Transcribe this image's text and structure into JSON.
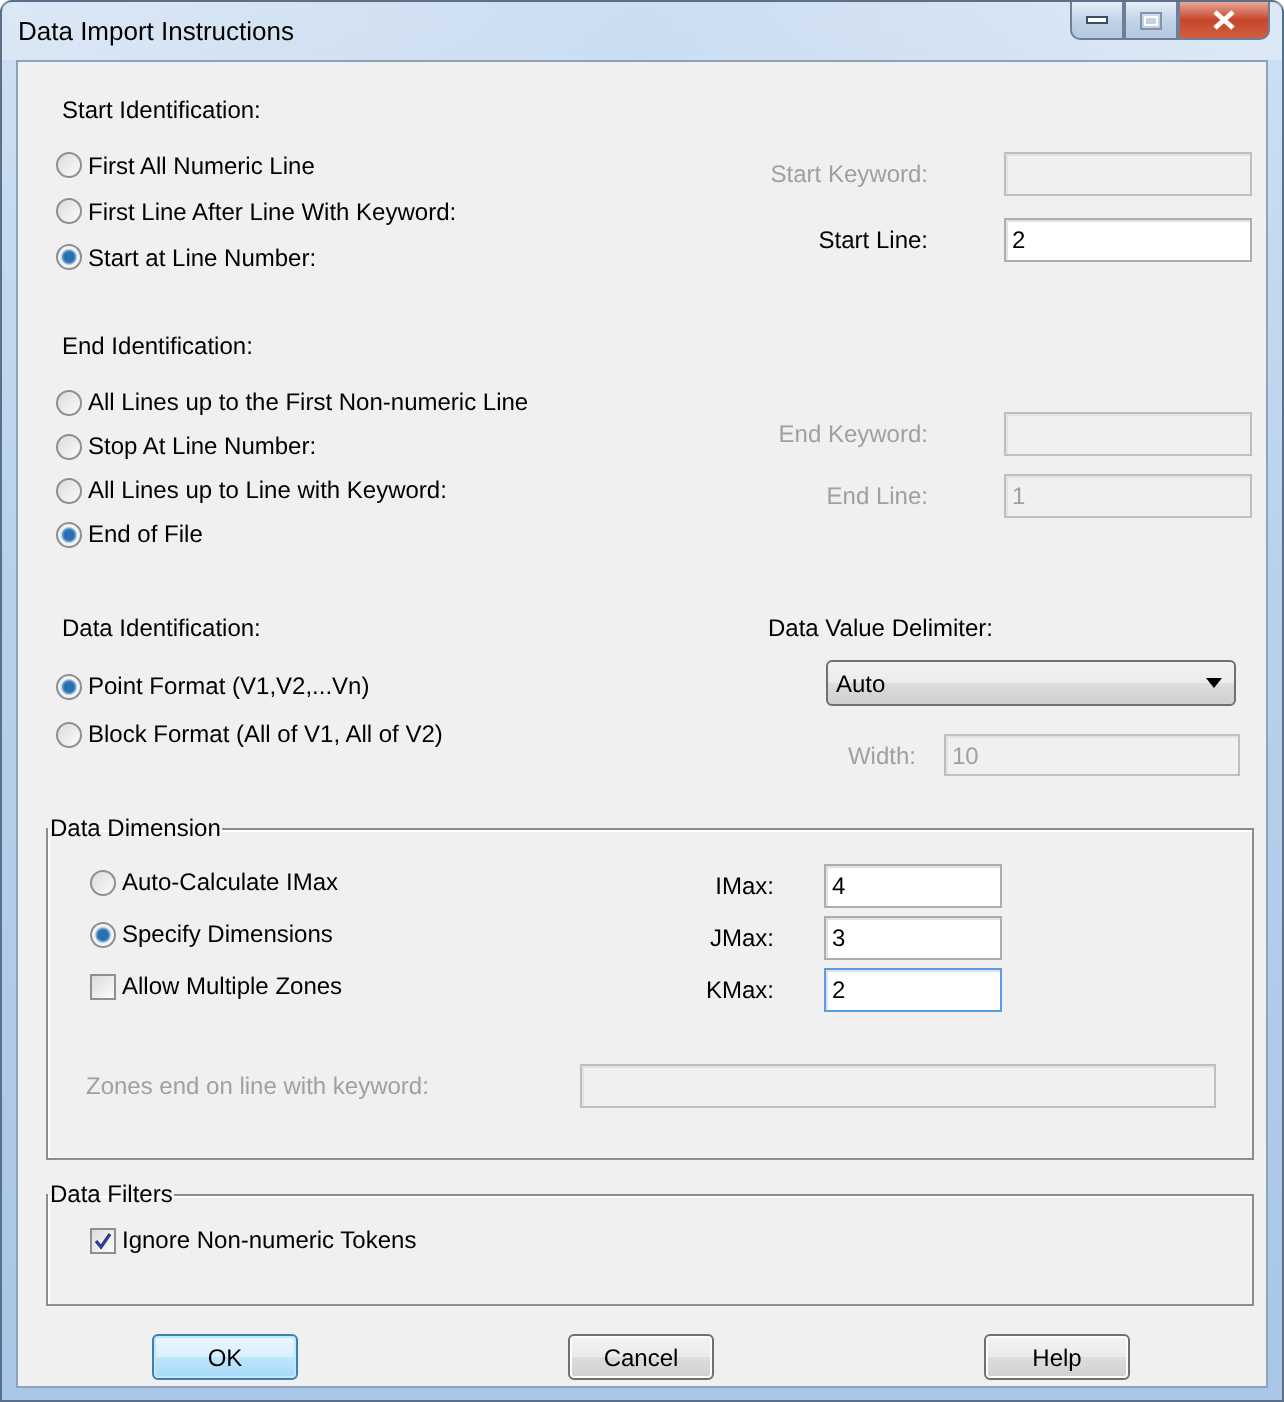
{
  "window": {
    "title": "Data Import Instructions"
  },
  "start": {
    "heading": "Start Identification:",
    "options": [
      {
        "label": "First All Numeric Line",
        "selected": false
      },
      {
        "label": "First Line After Line With Keyword:",
        "selected": false
      },
      {
        "label": "Start at Line Number:",
        "selected": true
      }
    ],
    "fields": [
      {
        "label": "Start Keyword:",
        "disabled": true
      },
      {
        "label": "Start Line:",
        "value": "2",
        "disabled": false
      }
    ]
  },
  "end": {
    "heading": "End Identification:",
    "options": [
      {
        "label": "All Lines up to the First Non-numeric Line",
        "selected": false
      },
      {
        "label": "Stop At Line Number:",
        "selected": false
      },
      {
        "label": "All Lines up to Line with Keyword:",
        "selected": false
      },
      {
        "label": "End of File",
        "selected": true
      }
    ],
    "fields": [
      {
        "label": "End Keyword:",
        "disabled": true
      },
      {
        "label": "End Line:",
        "value": "1",
        "disabled": true
      }
    ]
  },
  "data_identification": {
    "heading": "Data Identification:",
    "options": [
      {
        "label": "Point Format (V1,V2,...Vn)",
        "selected": true
      },
      {
        "label": "Block Format (All of V1, All of V2)",
        "selected": false
      }
    ],
    "delimiter": {
      "label": "Data Value Delimiter:",
      "value": "Auto"
    },
    "width": {
      "label": "Width:",
      "value": "10",
      "disabled": true
    }
  },
  "data_dimension": {
    "title": "Data Dimension",
    "options": [
      {
        "label": "Auto-Calculate IMax",
        "selected": false
      },
      {
        "label": "Specify Dimensions",
        "selected": true
      }
    ],
    "multiple_zones": {
      "label": "Allow Multiple Zones",
      "checked": false
    },
    "fields": [
      {
        "label": "IMax:",
        "value": "4",
        "focused": false
      },
      {
        "label": "JMax:",
        "value": "3",
        "focused": false
      },
      {
        "label": "KMax:",
        "value": "2",
        "focused": true
      }
    ],
    "zones_keyword": {
      "label": "Zones end on line with keyword:",
      "disabled": true
    }
  },
  "data_filters": {
    "title": "Data Filters",
    "ignore_tokens": {
      "label": "Ignore Non-numeric Tokens",
      "checked": true
    }
  },
  "buttons": [
    {
      "label": "OK",
      "default": true
    },
    {
      "label": "Cancel",
      "default": false
    },
    {
      "label": "Help",
      "default": false
    }
  ]
}
